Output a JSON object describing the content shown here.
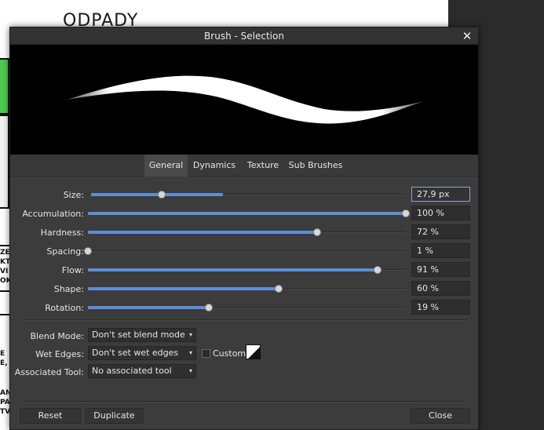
{
  "background": {
    "title_text": "ODPADY",
    "edge_texts": [
      "ZE",
      "KT",
      "VI",
      "OK",
      "E",
      "E,",
      "AN",
      "PA",
      "TV"
    ]
  },
  "dialog": {
    "title": "Brush - Selection",
    "close_glyph": "✕"
  },
  "tabs": [
    {
      "label": "General",
      "active": true
    },
    {
      "label": "Dynamics",
      "active": false
    },
    {
      "label": "Texture",
      "active": false
    },
    {
      "label": "Sub Brushes",
      "active": false
    }
  ],
  "sliders": [
    {
      "key": "size",
      "label": "Size:",
      "value": "27,9 px",
      "fraction": 0.224,
      "fill": 0.42
    },
    {
      "key": "accumulation",
      "label": "Accumulation:",
      "value": "100 %",
      "fraction": 1.0,
      "fill": 1.0
    },
    {
      "key": "hardness",
      "label": "Hardness:",
      "value": "72 %",
      "fraction": 0.72,
      "fill": 0.72
    },
    {
      "key": "spacing",
      "label": "Spacing:",
      "value": "1 %",
      "fraction": 0.0,
      "fill": 0.0
    },
    {
      "key": "flow",
      "label": "Flow:",
      "value": "91 %",
      "fraction": 0.91,
      "fill": 0.91
    },
    {
      "key": "shape",
      "label": "Shape:",
      "value": "60 %",
      "fraction": 0.6,
      "fill": 0.6
    },
    {
      "key": "rotation",
      "label": "Rotation:",
      "value": "19 %",
      "fraction": 0.38,
      "fill": 0.38
    }
  ],
  "options": {
    "blend_mode_label": "Blend Mode:",
    "blend_mode_value": "Don't set blend mode",
    "wet_edges_label": "Wet Edges:",
    "wet_edges_value": "Don't set wet edges",
    "custom_label": "Custom",
    "custom_checked": false,
    "associated_tool_label": "Associated Tool:",
    "associated_tool_value": "No associated tool",
    "caret_glyph": "▾"
  },
  "buttons": {
    "reset": "Reset",
    "duplicate": "Duplicate",
    "close": "Close"
  },
  "colors": {
    "slider_fill": "#5b8fd6",
    "dialog_bg": "#3c3c3c",
    "preview_bg": "#000000",
    "stroke": "#ffffff"
  }
}
